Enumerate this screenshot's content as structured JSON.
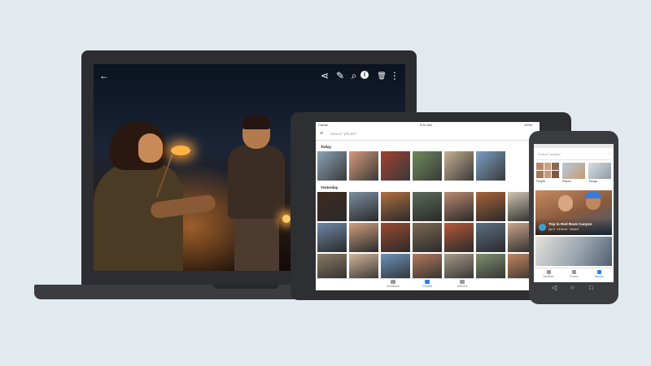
{
  "laptop": {
    "toolbar": {
      "back_icon": "←",
      "share_icon": "⋖",
      "edit_icon": "✎",
      "zoom_icon": "⌕",
      "info_icon": "i",
      "delete_icon": "🗑",
      "more_icon": "⋮"
    }
  },
  "tablet": {
    "status": {
      "carrier": "Carrier",
      "time": "9:41 AM",
      "battery": "100%"
    },
    "search_placeholder": "Search \"photos\"",
    "sections": [
      {
        "label": "Today"
      },
      {
        "label": "Yesterday"
      }
    ],
    "nav": [
      {
        "label": "Assistant"
      },
      {
        "label": "Photos"
      },
      {
        "label": "Albums"
      }
    ],
    "thumb_colors_today": [
      "#8aa3b8",
      "#d69a7a",
      "#a04030",
      "#6e8a5a",
      "#c7b090",
      "#7aa0c6"
    ],
    "thumb_colors_yesterday": [
      "#3e2b22",
      "#7a8ea0",
      "#b07040",
      "#5a6b5a",
      "#b98a70",
      "#a6633a",
      "#cfc6b2",
      "#6e88a6",
      "#cfa080",
      "#9c4a30",
      "#7c6a52",
      "#b45a3a",
      "#5d6f84",
      "#c9a58c",
      "#8a7a64",
      "#d2b59a",
      "#6d93b8",
      "#b27a5e",
      "#a79a88",
      "#7f8f6e",
      "#c2865e"
    ]
  },
  "phone": {
    "search_placeholder": "Search \"photos\"",
    "categories": [
      {
        "label": "People"
      },
      {
        "label": "Places"
      },
      {
        "label": "Things"
      }
    ],
    "album_card": {
      "title": "Trip to Red Rock Canyon",
      "subtitle": "Apr 8 · 18 items · Shared"
    },
    "nav": [
      {
        "label": "Assistant"
      },
      {
        "label": "Photos"
      },
      {
        "label": "Albums"
      }
    ],
    "system_nav": {
      "back": "◁",
      "home": "○",
      "recents": "□"
    }
  }
}
